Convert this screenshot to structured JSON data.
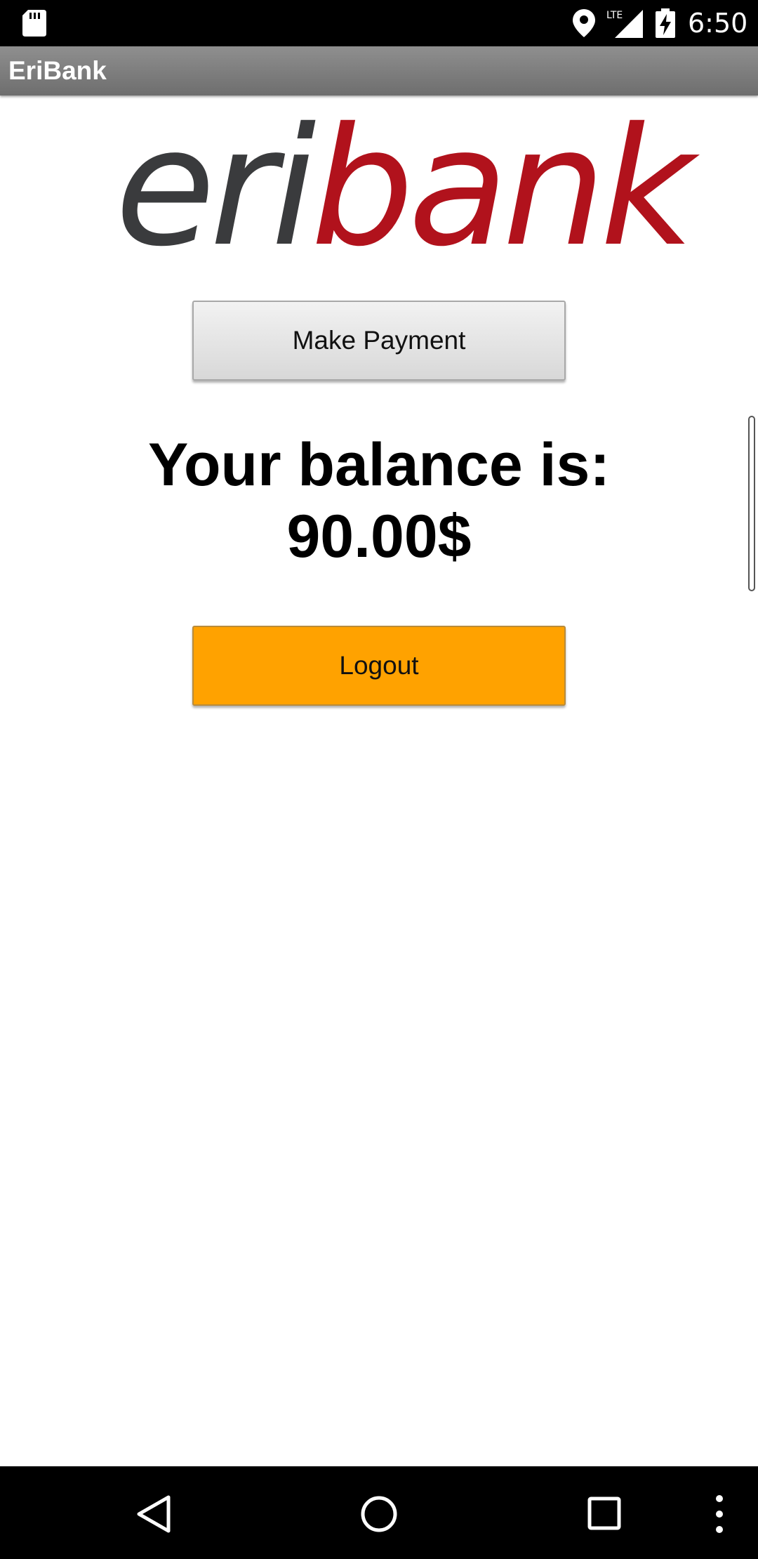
{
  "status_bar": {
    "time": "6:50",
    "network": "LTE",
    "icons": [
      "sd-card-icon",
      "location-icon",
      "lte-signal-icon",
      "battery-charging-icon"
    ]
  },
  "app_bar": {
    "title": "EriBank"
  },
  "logo": {
    "part1": "eri",
    "part2": "bank",
    "colors": {
      "eri": "#3a3b3d",
      "bank": "#b1121c"
    }
  },
  "main": {
    "make_payment_label": "Make Payment",
    "balance_label": "Your balance is:",
    "balance_amount": "90.00$",
    "logout_label": "Logout"
  },
  "colors": {
    "logout_button": "#ffa200",
    "app_bar": "#7d7d7d"
  },
  "nav_bar": {
    "icons": [
      "back-icon",
      "home-icon",
      "recents-icon",
      "more-icon"
    ]
  }
}
